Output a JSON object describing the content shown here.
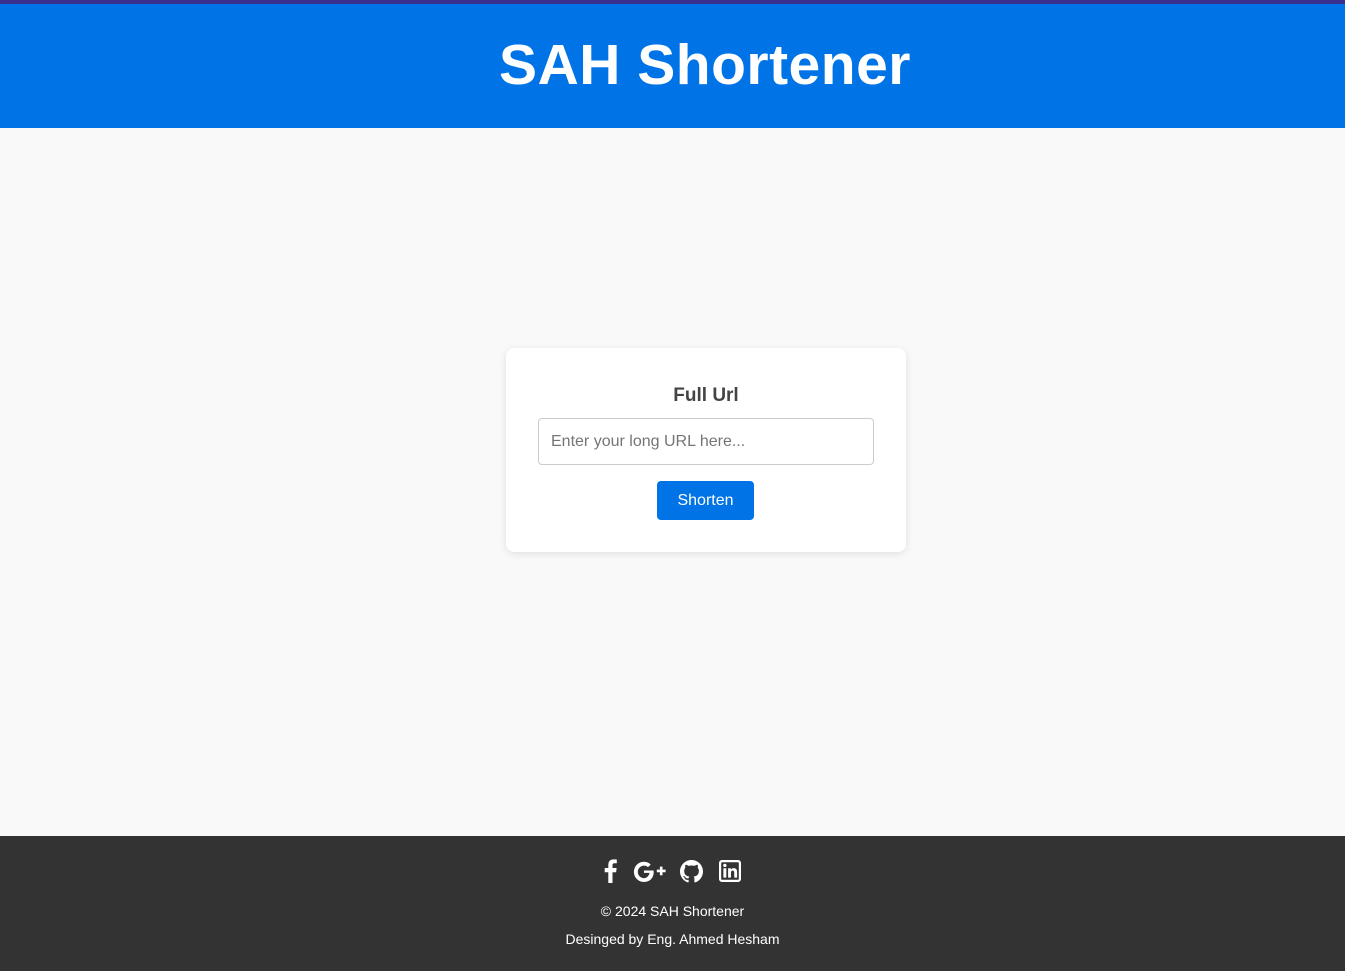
{
  "header": {
    "title": "SAH Shortener"
  },
  "form": {
    "label": "Full Url",
    "input_value": "",
    "input_placeholder": "Enter your long URL here...",
    "submit_label": "Shorten"
  },
  "footer": {
    "social_icons": [
      "facebook-icon",
      "google-plus-icon",
      "github-icon",
      "linkedin-icon"
    ],
    "copyright": "© 2024 SAH Shortener",
    "credit": "Desinged by Eng. Ahmed Hesham"
  },
  "colors": {
    "primary": "#0073e6",
    "top_strip": "#3b2f8f",
    "footer_bg": "#333333",
    "page_bg": "#f9f9f9"
  }
}
